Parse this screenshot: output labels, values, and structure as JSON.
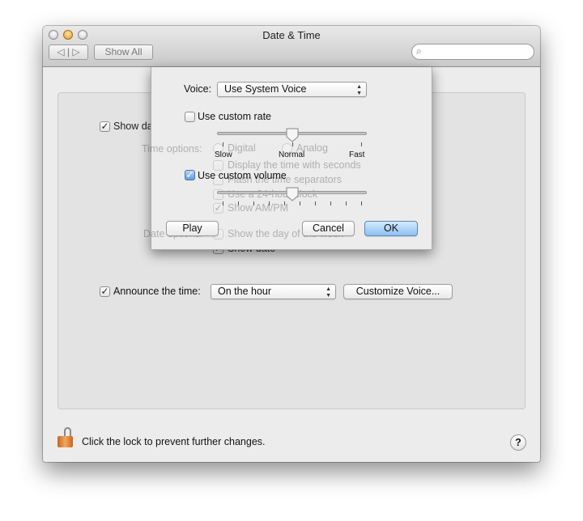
{
  "window": {
    "title": "Date & Time",
    "show_all": "Show All",
    "search_placeholder": ""
  },
  "background": {
    "show_menu_bar": "Show date and time in menu bar",
    "show_menu_bar_checked": true,
    "time_options_label": "Time options:",
    "digital": "Digital",
    "analog": "Analog",
    "display_seconds": "Display the time with seconds",
    "flash_separators": "Flash the time separators",
    "use_24_hour": "Use a 24-hour clock",
    "show_ampm": "Show AM/PM",
    "show_ampm_checked": true,
    "date_options_label": "Date options:",
    "show_day_of_week": "Show the day of the week",
    "show_date": "Show date",
    "show_date_checked": true
  },
  "announce": {
    "label": "Announce the time:",
    "checked": true,
    "interval": "On the hour",
    "customize": "Customize Voice..."
  },
  "footer": {
    "lock_text": "Click the lock to prevent further changes.",
    "help": "?"
  },
  "sheet": {
    "voice_label": "Voice:",
    "voice_value": "Use System Voice",
    "custom_rate": "Use custom rate",
    "custom_rate_checked": false,
    "rate_value": 0.5,
    "slow": "Slow",
    "normal": "Normal",
    "fast": "Fast",
    "custom_volume": "Use custom volume",
    "custom_volume_checked": true,
    "volume_value": 0.5,
    "play": "Play",
    "cancel": "Cancel",
    "ok": "OK"
  },
  "colors": {
    "accent": "#8dc0f2",
    "lock": "#d9822b"
  }
}
